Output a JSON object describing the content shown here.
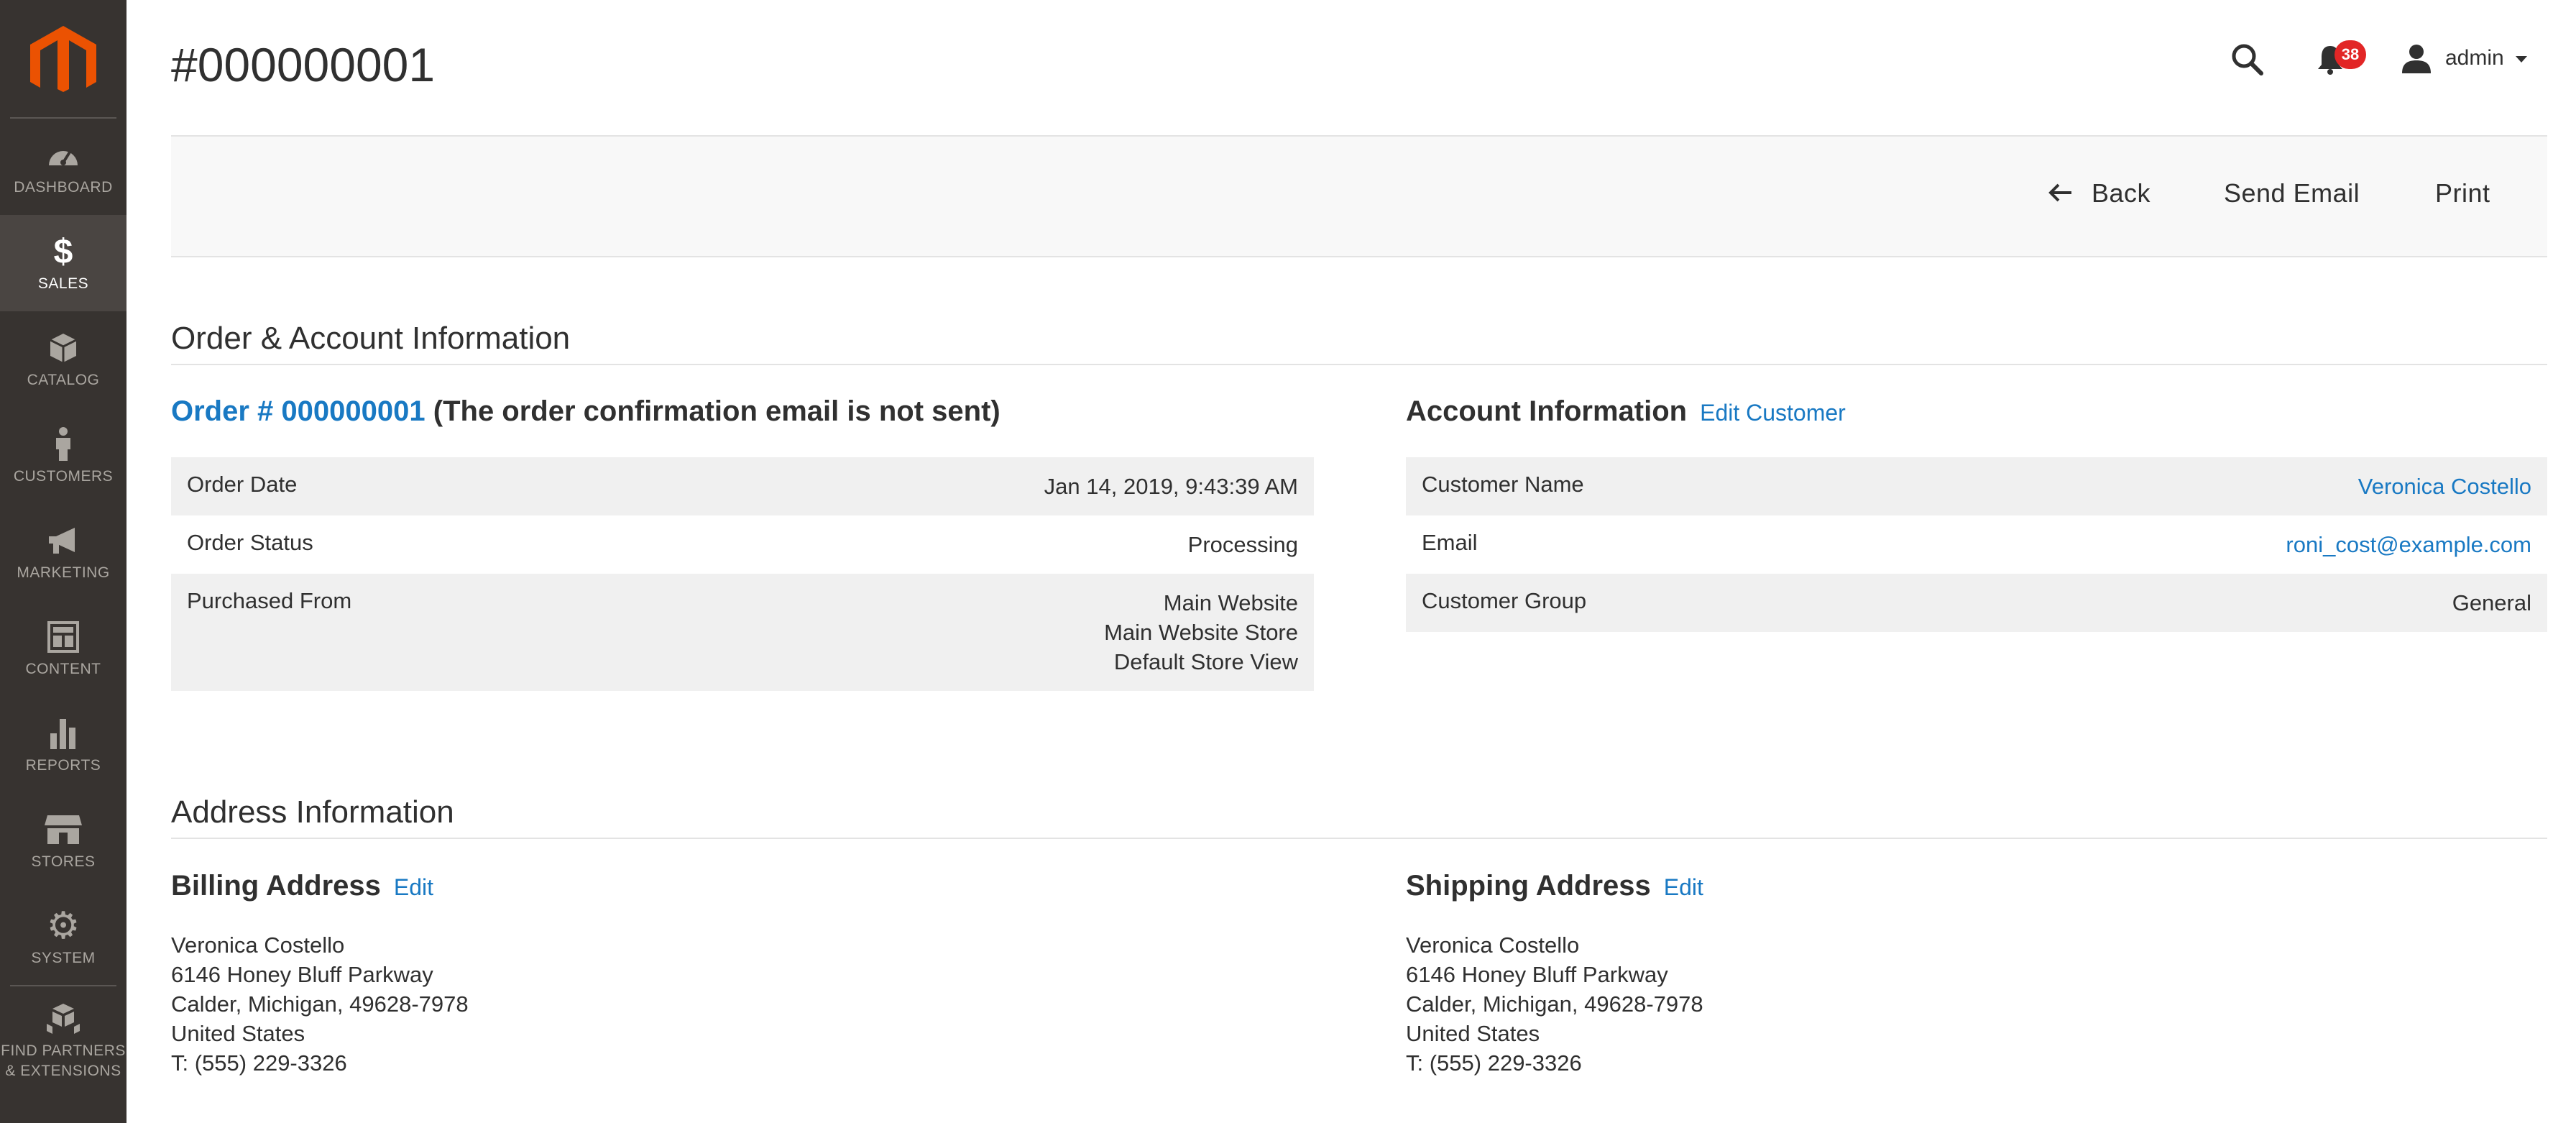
{
  "sidebar": {
    "items": [
      {
        "label": "DASHBOARD",
        "icon": "dashboard-icon"
      },
      {
        "label": "SALES",
        "icon": "dollar-icon",
        "active": true
      },
      {
        "label": "CATALOG",
        "icon": "box-icon"
      },
      {
        "label": "CUSTOMERS",
        "icon": "person-icon"
      },
      {
        "label": "MARKETING",
        "icon": "megaphone-icon"
      },
      {
        "label": "CONTENT",
        "icon": "layout-icon"
      },
      {
        "label": "REPORTS",
        "icon": "bar-chart-icon"
      },
      {
        "label": "STORES",
        "icon": "store-icon"
      },
      {
        "label": "SYSTEM",
        "icon": "gear-icon"
      },
      {
        "label_line1": "FIND PARTNERS",
        "label_line2": "& EXTENSIONS",
        "icon": "cubes-icon"
      }
    ]
  },
  "header": {
    "title": "#000000001",
    "notifications_count": "38",
    "user": "admin"
  },
  "actions": {
    "back": "Back",
    "send_email": "Send Email",
    "print": "Print"
  },
  "order_account": {
    "section_title": "Order & Account Information",
    "order": {
      "title_link": "Order # 000000001",
      "title_note": "(The order confirmation email is not sent)",
      "rows": [
        {
          "label": "Order Date",
          "value": "Jan 14, 2019, 9:43:39 AM"
        },
        {
          "label": "Order Status",
          "value": "Processing"
        },
        {
          "label": "Purchased From",
          "value_lines": [
            "Main Website",
            "Main Website Store",
            "Default Store View"
          ]
        }
      ]
    },
    "account": {
      "title": "Account Information",
      "edit_link": "Edit Customer",
      "rows": [
        {
          "label": "Customer Name",
          "value": "Veronica Costello"
        },
        {
          "label": "Email",
          "value": "roni_cost@example.com"
        },
        {
          "label": "Customer Group",
          "value": "General"
        }
      ]
    }
  },
  "address": {
    "section_title": "Address Information",
    "billing": {
      "title": "Billing Address",
      "edit": "Edit",
      "lines": [
        "Veronica Costello",
        "6146 Honey Bluff Parkway",
        "Calder, Michigan, 49628-7978",
        "United States",
        "T: (555) 229-3326"
      ]
    },
    "shipping": {
      "title": "Shipping Address",
      "edit": "Edit",
      "lines": [
        "Veronica Costello",
        "6146 Honey Bluff Parkway",
        "Calder, Michigan, 49628-7978",
        "United States",
        "T: (555) 229-3326"
      ]
    }
  },
  "colors": {
    "sidebar_bg": "#373330",
    "sidebar_active": "#4a4542",
    "brand_orange": "#eb5202",
    "link": "#1979c3",
    "badge": "#e22626"
  }
}
